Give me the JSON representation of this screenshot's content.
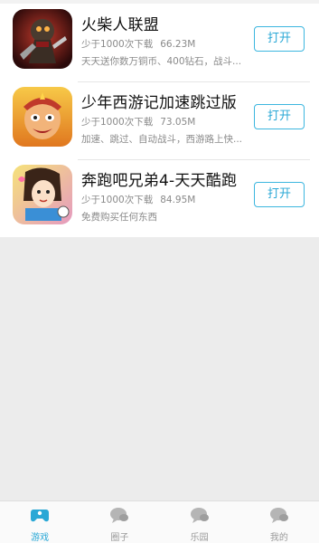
{
  "apps": [
    {
      "name": "火柴人联盟",
      "downloads": "少于1000次下载",
      "size": "66.23M",
      "description": "天天送你数万铜币、400钻石，战斗...",
      "button_label": "打开"
    },
    {
      "name": "少年西游记加速跳过版",
      "downloads": "少于1000次下载",
      "size": "73.05M",
      "description": "加速、跳过、自动战斗，西游路上快...",
      "button_label": "打开"
    },
    {
      "name": "奔跑吧兄弟4-天天酷跑",
      "downloads": "少于1000次下载",
      "size": "84.95M",
      "description": "免费购买任何东西",
      "button_label": "打开"
    }
  ],
  "tabbar": {
    "items": [
      {
        "label": "游戏",
        "icon": "gamepad-icon",
        "active": true
      },
      {
        "label": "圈子",
        "icon": "chat-bubble-icon",
        "active": false
      },
      {
        "label": "乐园",
        "icon": "chat-bubble-icon",
        "active": false
      },
      {
        "label": "我的",
        "icon": "chat-bubble-icon",
        "active": false
      }
    ]
  },
  "colors": {
    "accent": "#2aa8d6",
    "inactive": "#9a9a9a",
    "background": "#ececec"
  }
}
